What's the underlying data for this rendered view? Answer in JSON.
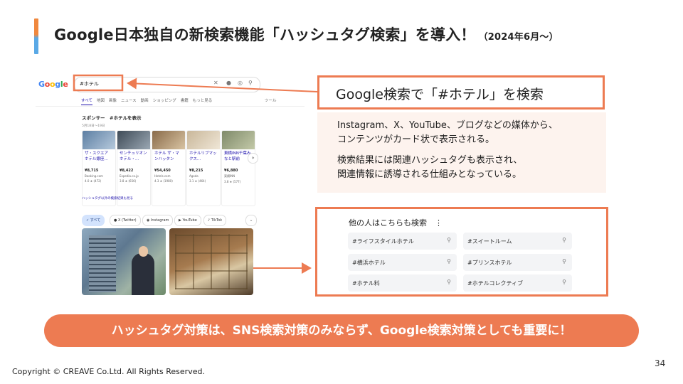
{
  "title": {
    "main": "Google日本独自の新検索機能「ハッシュタグ検索」を導入！",
    "sub": "（2024年6月〜）"
  },
  "google": {
    "logo": "Google",
    "query": "#ホテル",
    "tabs": [
      "すべて",
      "地図",
      "画像",
      "ニュース",
      "動画",
      "ショッピング",
      "書籍",
      "もっと見る"
    ],
    "tools": "ツール",
    "sponsor": "スポンサー　#ホテルを表示",
    "date": "5月18日〜19日",
    "hotels": [
      {
        "name": "ザ・スクエア ホテル銀座...",
        "price": "¥8,715",
        "site": "Booking.com",
        "rating": "4.0 ★ (472)"
      },
      {
        "name": "センチュリオン ホテル・...",
        "price": "¥8,422",
        "site": "Expedia.co.jp",
        "rating": "3.8 ★ (656)"
      },
      {
        "name": "ホテル ザ・マンハッタン",
        "price": "¥54,450",
        "site": "Hotels.com",
        "rating": "4.3 ★ (1980)"
      },
      {
        "name": "ホテルリブマックス...",
        "price": "¥8,215",
        "site": "Agoda",
        "rating": "3.1 ★ (464)"
      },
      {
        "name": "東横INN千葉みなと駅前",
        "price": "¥6,880",
        "site": "東横INN",
        "rating": "3.8 ★ (577)"
      }
    ],
    "related_link": "ハッシュタグ以外の検索結果も見る",
    "chips": [
      "すべて",
      "X (Twitter)",
      "Instagram",
      "YouTube",
      "TikTok"
    ]
  },
  "callout1": {
    "text": "Google検索で「#ホテル」を検索"
  },
  "description": {
    "p1": [
      "Instagram、X、YouTube、ブログなどの媒体から、",
      "コンテンツがカード状で表示される。"
    ],
    "p2": [
      "検索結果には関連ハッシュタグも表示され、",
      "関連情報に誘導される仕組みとなっている。"
    ]
  },
  "related_searches": {
    "title": "他の人はこちらも検索　⋮",
    "items": [
      "#ライフスタイルホテル",
      "#スイートルーム",
      "#横浜ホテル",
      "#プリンスホテル",
      "#ホテル料",
      "#ホテルコレクティブ"
    ]
  },
  "banner": "ハッシュタグ対策は、SNS検索対策のみならず、Google検索対策としても重要に！",
  "page_number": "34",
  "copyright": "Copyright © CREAVE Co.Ltd. All Rights Reserved.",
  "colors": {
    "accent": "#ed7b52",
    "desc_bg": "#fdf3ee",
    "title_bar_top": "#f0883e",
    "title_bar_bottom": "#5aa9e6"
  }
}
